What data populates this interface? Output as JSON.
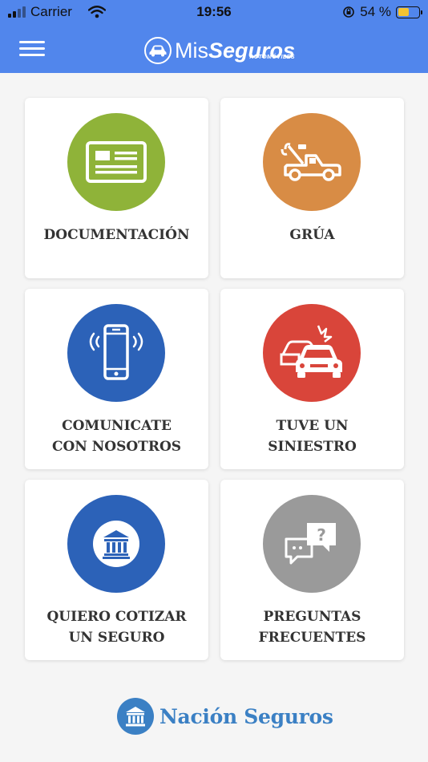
{
  "status_bar": {
    "carrier": "Carrier",
    "time": "19:56",
    "battery_percent": "54 %",
    "battery_level": 0.54
  },
  "header": {
    "logo_mis": "Mis",
    "logo_seguros": "Seguros",
    "logo_sub": "AUTOMÓVILES",
    "background": "#5186ec"
  },
  "cards": [
    {
      "label_line1": "DOCUMENTACIÓN",
      "label_line2": "",
      "color": "#8fb339",
      "icon": "id-card-icon"
    },
    {
      "label_line1": "GRÚA",
      "label_line2": "",
      "color": "#d88c45",
      "icon": "tow-truck-icon"
    },
    {
      "label_line1": "COMUNICATE",
      "label_line2": "CON NOSOTROS",
      "color": "#2c62b8",
      "icon": "phone-icon"
    },
    {
      "label_line1": "TUVE UN",
      "label_line2": "SINIESTRO",
      "color": "#d9453a",
      "icon": "car-crash-icon"
    },
    {
      "label_line1": "QUIERO COTIZAR",
      "label_line2": "UN SEGURO",
      "color": "#2c62b8",
      "icon": "bank-icon"
    },
    {
      "label_line1": "PREGUNTAS",
      "label_line2": "FRECUENTES",
      "color": "#9a9a9a",
      "icon": "chat-question-icon"
    }
  ],
  "footer": {
    "brand": "Nación Seguros",
    "color": "#3b80c4"
  }
}
